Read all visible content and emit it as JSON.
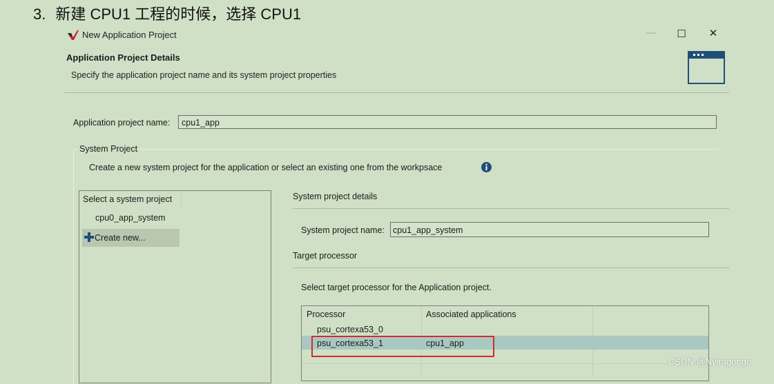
{
  "caption": {
    "number": "3.",
    "text": "新建 CPU1 工程的时候，选择 CPU1"
  },
  "window": {
    "title": "New Application Project",
    "minimize": "—",
    "maximize": "☐",
    "close": "✕"
  },
  "header": {
    "title": "Application Project Details",
    "subtitle": "Specify the application project name and its system project properties"
  },
  "form": {
    "app_name_label": "Application project name:",
    "app_name_value": "cpu1_app"
  },
  "system_project": {
    "group_label": "System Project",
    "description": "Create a new system project for the application or select an existing one from the workpsace",
    "list_header": "Select a system project",
    "items": [
      {
        "label": "cpu0_app_system"
      },
      {
        "label": "Create new..."
      }
    ],
    "details_label": "System project details",
    "name_label": "System project name:",
    "name_value": "cpu1_app_system"
  },
  "target": {
    "section_label": "Target processor",
    "instruction": "Select target processor for the Application project.",
    "columns": [
      "Processor",
      "Associated applications"
    ],
    "rows": [
      {
        "processor": "psu_cortexa53_0",
        "app": ""
      },
      {
        "processor": "psu_cortexa53_1",
        "app": "cpu1_app"
      }
    ]
  },
  "colors": {
    "background": "#cfe0c6",
    "selection": "#a9c8c1",
    "highlight_border": "#d42a2a",
    "accent": "#1f4e79"
  },
  "watermark": "CSDN @Nyiragongo"
}
